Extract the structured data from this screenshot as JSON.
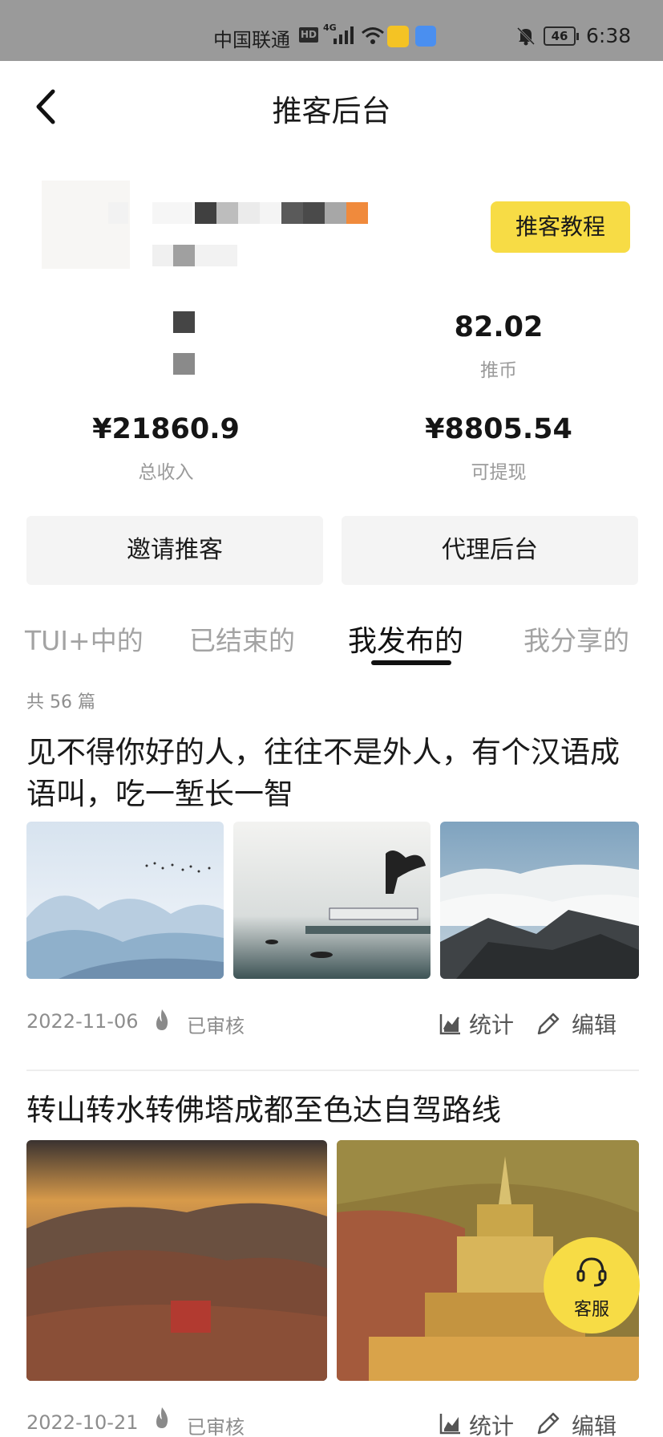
{
  "status_bar": {
    "carrier": "中国联通",
    "hd": "HD",
    "network": "4G",
    "battery": "46",
    "time": "6:38"
  },
  "header": {
    "title": "推客后台",
    "back_icon": "chevron-left-icon"
  },
  "profile": {
    "tutorial_button": "推客教程"
  },
  "stats": {
    "tuibi_value": "82.02",
    "tuibi_label": "推币",
    "total_income_value": "¥21860.9",
    "total_income_label": "总收入",
    "withdrawable_value": "¥8805.54",
    "withdrawable_label": "可提现"
  },
  "actions": {
    "invite": "邀请推客",
    "agent": "代理后台"
  },
  "tabs": [
    {
      "label": "TUI+中的"
    },
    {
      "label": "已结束的"
    },
    {
      "label": "我发布的"
    },
    {
      "label": "我分享的"
    }
  ],
  "active_tab": "我发布的",
  "list": {
    "count_text": "共 56 篇",
    "articles": [
      {
        "title": "见不得你好的人，往往不是外人，有个汉语成语叫，吃一堑长一智",
        "date": "2022-11-06",
        "status": "已审核",
        "stats_label": "统计",
        "edit_label": "编辑"
      },
      {
        "title": "转山转水转佛塔成都至色达自驾路线",
        "date": "2022-10-21",
        "status": "已审核",
        "stats_label": "统计",
        "edit_label": "编辑"
      }
    ]
  },
  "customer_service": {
    "label": "客服",
    "icon": "headset-icon"
  },
  "colors": {
    "accent_yellow": "#f7dc45",
    "status_bar": "#9a9a9a"
  }
}
